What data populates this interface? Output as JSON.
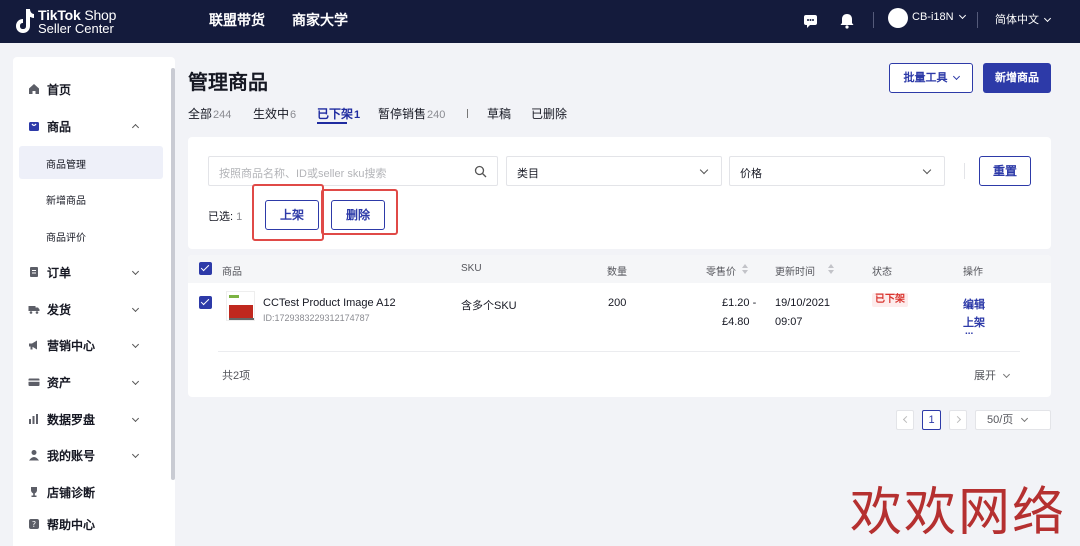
{
  "topbar": {
    "logo_line1_bold": "TikTok",
    "logo_line1_rest": " Shop",
    "logo_line2": "Seller Center",
    "nav": [
      "联盟带货",
      "商家大学"
    ],
    "account": "CB-i18N",
    "language": "简体中文",
    "icons": [
      "chat-icon",
      "bell-icon",
      "avatar"
    ]
  },
  "sidebar": {
    "items": [
      {
        "label": "首页",
        "icon": "home-icon"
      },
      {
        "label": "商品",
        "icon": "product-bag-icon",
        "expanded": true,
        "children": [
          {
            "label": "商品管理",
            "active": true
          },
          {
            "label": "新增商品"
          },
          {
            "label": "商品评价"
          }
        ]
      },
      {
        "label": "订单",
        "icon": "order-icon"
      },
      {
        "label": "发货",
        "icon": "truck-icon"
      },
      {
        "label": "营销中心",
        "icon": "megaphone-icon"
      },
      {
        "label": "资产",
        "icon": "wallet-icon"
      },
      {
        "label": "数据罗盘",
        "icon": "chart-icon"
      },
      {
        "label": "我的账号",
        "icon": "user-icon"
      },
      {
        "label": "店铺诊断",
        "icon": "trophy-icon"
      },
      {
        "label": "帮助中心",
        "icon": "help-icon"
      }
    ]
  },
  "page": {
    "title": "管理商品",
    "batch_tool": "批量工具",
    "add_product": "新增商品"
  },
  "tabs": [
    {
      "label": "全部",
      "count": "244"
    },
    {
      "label": "生效中",
      "count": "6"
    },
    {
      "label": "已下架",
      "count": "1",
      "active": true
    },
    {
      "label": "暂停销售",
      "count": "240"
    },
    {
      "label": "草稿",
      "count": ""
    },
    {
      "label": "已删除",
      "count": ""
    }
  ],
  "filters": {
    "search_placeholder": "按照商品名称、ID或seller sku搜索",
    "category": "类目",
    "price": "价格",
    "reset": "重置"
  },
  "selection": {
    "label": "已选:",
    "count": "1",
    "list_button": "上架",
    "delete_button": "删除"
  },
  "table": {
    "headers": {
      "product": "商品",
      "sku": "SKU",
      "quantity": "数量",
      "price": "零售价",
      "updated": "更新时间",
      "status": "状态",
      "actions": "操作"
    },
    "rows": [
      {
        "name": "CCTest Product Image A12",
        "id": "ID:1729383229312174787",
        "sku": "含多个SKU",
        "quantity": "200",
        "price_low": "£1.20 -",
        "price_high": "£4.80",
        "date": "19/10/2021",
        "time": "09:07",
        "status": "已下架",
        "action_edit": "编辑",
        "action_list": "上架",
        "action_more": "..."
      }
    ],
    "total": "共2项",
    "expand": "展开"
  },
  "pagination": {
    "current_page": "1",
    "page_size": "50/页"
  },
  "watermark": "欢欢网络",
  "colors": {
    "topbar": "#141b3c",
    "primary": "#2d3aa8",
    "highlight_box": "#e04a47",
    "status_red": "#d9352f"
  }
}
